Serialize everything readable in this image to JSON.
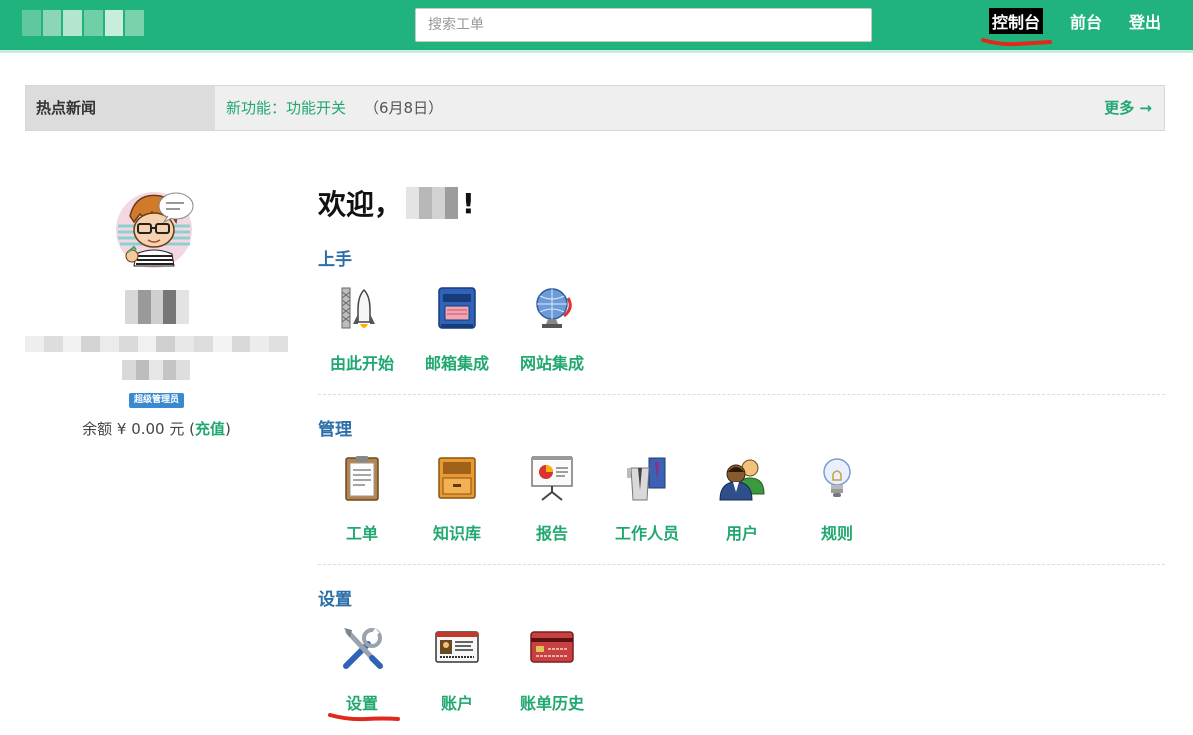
{
  "header": {
    "search_placeholder": "搜索工单",
    "nav": {
      "console": "控制台",
      "front": "前台",
      "logout": "登出"
    }
  },
  "news": {
    "label": "热点新闻",
    "link_text": "新功能：功能开关",
    "date": "（6月8日）",
    "more": "更多 →"
  },
  "profile": {
    "badge": "超级管理员",
    "balance_prefix": "余额 ¥ 0.00 元 (",
    "recharge": "充值",
    "balance_suffix": ")"
  },
  "welcome": {
    "prefix": "欢迎，",
    "suffix": "!"
  },
  "sections": {
    "getting_started": {
      "title": "上手",
      "items": [
        "由此开始",
        "邮箱集成",
        "网站集成"
      ]
    },
    "manage": {
      "title": "管理",
      "items": [
        "工单",
        "知识库",
        "报告",
        "工作人员",
        "用户",
        "规则"
      ]
    },
    "settings": {
      "title": "设置",
      "items": [
        "设置",
        "账户",
        "账单历史"
      ]
    }
  },
  "colors": {
    "brand_green": "#21b37e",
    "link_green": "#21a870",
    "section_blue": "#2c6fa8",
    "annotation_red": "#e0281c"
  }
}
